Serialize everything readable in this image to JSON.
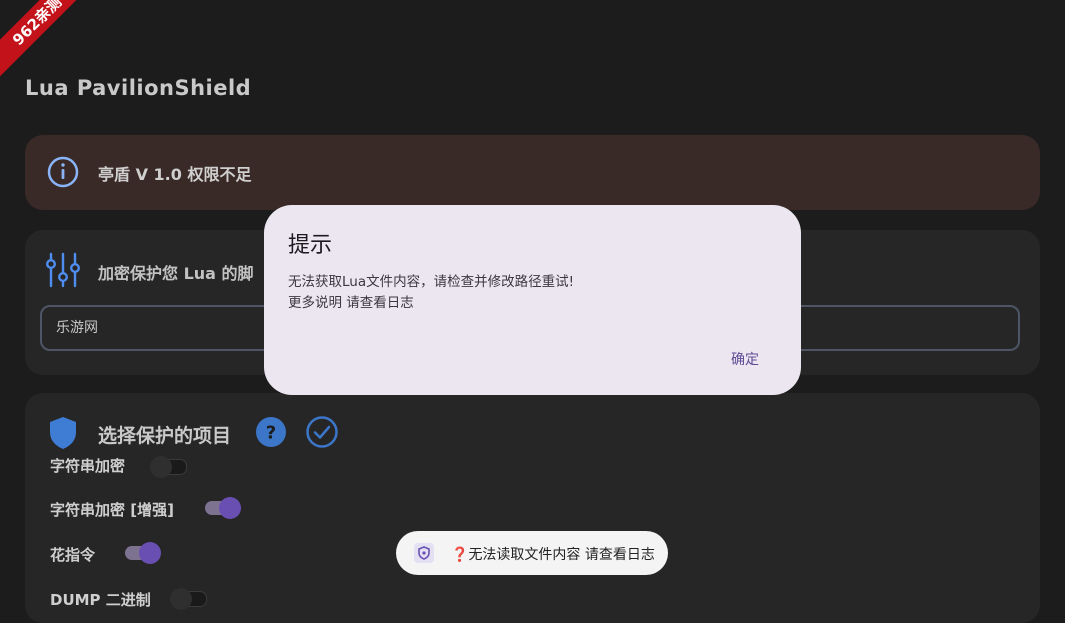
{
  "watermark": {
    "text": "962亲测"
  },
  "app": {
    "title": "Lua  PavilionShield"
  },
  "alert": {
    "text": "亭盾  V  1.0   权限不足"
  },
  "encrypt": {
    "title": "加密保护您  Lua  的脚",
    "field_value": "乐游网"
  },
  "options": {
    "title": "选择保护的项目",
    "items": [
      {
        "label": "字符串加密",
        "on": false
      },
      {
        "label": "字符串加密 [增强]",
        "on": true
      },
      {
        "label": "花指令",
        "on": true
      },
      {
        "label": "DUMP 二进制",
        "on": false
      }
    ]
  },
  "dialog": {
    "title": "提示",
    "message_line1": "无法获取Lua文件内容，请检查并修改路径重试!",
    "message_line2": "更多说明 请查看日志",
    "ok_label": "确定"
  },
  "toast": {
    "icon_glyph": "❓",
    "text": "无法读取文件内容 请查看日志"
  },
  "colors": {
    "background": "#1c1c1c",
    "alert_card": "#3a2a27",
    "card": "#262626",
    "accent_blue": "#3c76c9",
    "switch_on": "#6a4fb3",
    "dialog_bg": "#ece6f0",
    "watermark": "#c3121a"
  }
}
